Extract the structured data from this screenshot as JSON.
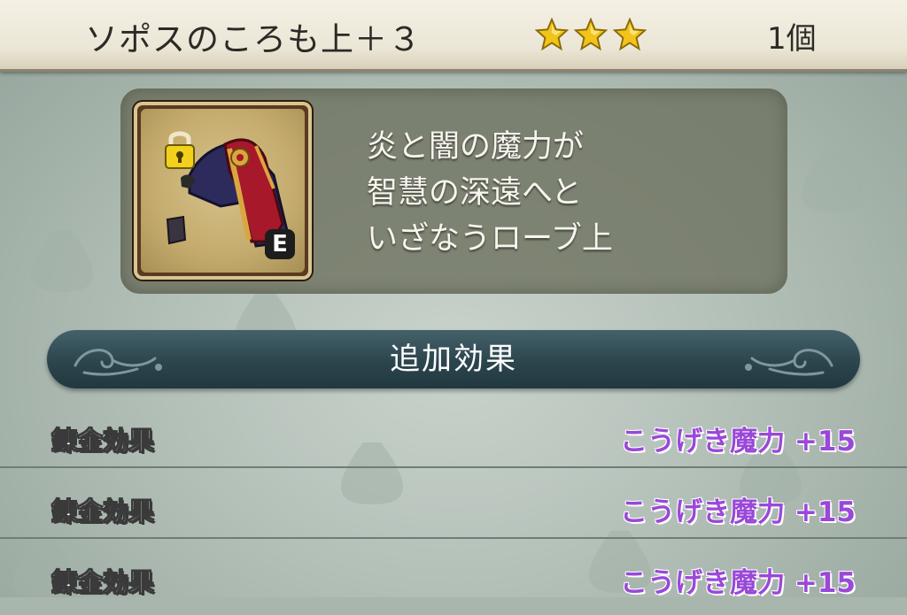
{
  "item": {
    "name": "ソポスのころも上＋３",
    "stars": 3,
    "quantity": "1個",
    "equipped_badge": "E",
    "description": [
      "炎と闇の魔力が",
      "智慧の深遠へと",
      "いざなうローブ上"
    ]
  },
  "section": {
    "title": "追加効果"
  },
  "effects": [
    {
      "label": "錬金効果",
      "value": "こうげき魔力  +15"
    },
    {
      "label": "錬金効果",
      "value": "こうげき魔力  +15"
    },
    {
      "label": "錬金効果",
      "value": "こうげき魔力  +15"
    }
  ],
  "icons": {
    "star": "star-icon",
    "lock": "lock-icon",
    "robe": "robe-icon"
  },
  "colors": {
    "star": "#f2c318",
    "effect_value": "#9a48d8",
    "section_bar": "#2c454d"
  }
}
